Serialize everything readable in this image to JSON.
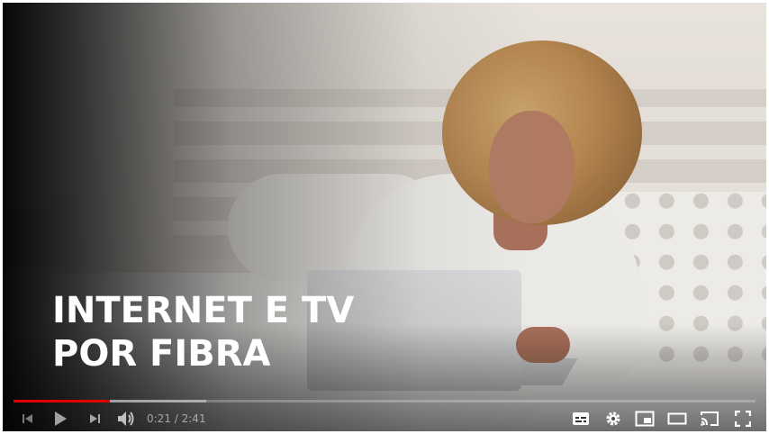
{
  "video": {
    "headline_line1": "INTERNET E TV",
    "headline_line2": "POR FIBRA"
  },
  "player": {
    "current_time": "0:21",
    "time_separator": " / ",
    "duration": "2:41",
    "progress": 0.13,
    "buffered": 0.26,
    "progress_color": "#e00000"
  },
  "icons": {
    "previous": "previous-icon",
    "play": "play-icon",
    "next": "next-icon",
    "volume": "volume-icon",
    "subtitles": "subtitles-icon",
    "settings": "gear-icon",
    "miniplayer": "miniplayer-icon",
    "theater": "theater-mode-icon",
    "cast": "cast-icon",
    "fullscreen": "fullscreen-icon"
  }
}
